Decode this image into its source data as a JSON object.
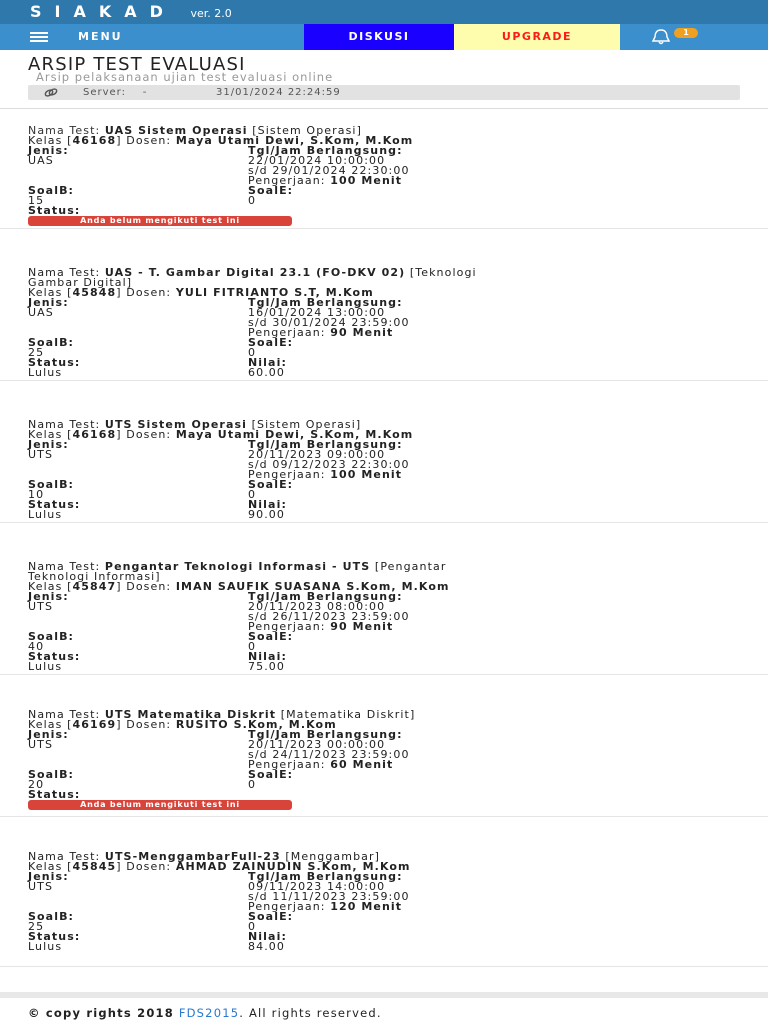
{
  "app": {
    "brand": "SIAKAD",
    "version": "ver. 2.0"
  },
  "nav": {
    "menu_label": "MENU",
    "diskusi_label": "DISKUSI",
    "upgrade_label": "UPGRADE",
    "notification_count": "1"
  },
  "header": {
    "title": "ARSIP TEST EVALUASI",
    "subtitle": "Arsip pelaksanaan ujian test evaluasi online",
    "server_label": "Server:",
    "server_sep": "-",
    "server_time": "31/01/2024 22:24:59"
  },
  "labels": {
    "nama_test": "Nama Test:",
    "kelas": "Kelas",
    "dosen": "Dosen:",
    "jenis": "Jenis:",
    "tgl": "Tgl/Jam Berlangsung:",
    "sd": "s/d",
    "pengerjaan": "Pengerjaan:",
    "soalb": "SoalB:",
    "soale": "SoalE:",
    "status": "Status:",
    "nilai": "Nilai:"
  },
  "tests": [
    {
      "name": "UAS Sistem Operasi",
      "course": "[Sistem Operasi]",
      "kelas": "46168",
      "dosen": "Maya Utami Dewi, S.Kom, M.Kom",
      "jenis": "UAS",
      "start": "22/01/2024 10:00:00",
      "end": "29/01/2024 22:30:00",
      "duration": "100 Menit",
      "soalb": "15",
      "soale": "0",
      "status": "",
      "nilai": "",
      "badge": "Anda belum mengikuti test ini"
    },
    {
      "name": "UAS - T. Gambar Digital 23.1 (FO-DKV 02)",
      "course": "[Teknologi",
      "course_cont": "Gambar Digital]",
      "kelas": "45848",
      "dosen": "YULI FITRIANTO S.T, M.Kom",
      "jenis": "UAS",
      "start": "16/01/2024 13:00:00",
      "end": "30/01/2024 23:59:00",
      "duration": "90 Menit",
      "soalb": "25",
      "soale": "0",
      "status": "Lulus",
      "nilai": "60.00"
    },
    {
      "name": "UTS Sistem Operasi",
      "course": "[Sistem Operasi]",
      "kelas": "46168",
      "dosen": "Maya Utami Dewi, S.Kom, M.Kom",
      "jenis": "UTS",
      "start": "20/11/2023 09:00:00",
      "end": "09/12/2023 22:30:00",
      "duration": "100 Menit",
      "soalb": "10",
      "soale": "0",
      "status": "Lulus",
      "nilai": "90.00"
    },
    {
      "name": "Pengantar Teknologi Informasi - UTS",
      "course": "[Pengantar",
      "course_cont": "Teknologi Informasi]",
      "kelas": "45847",
      "dosen": "IMAN SAUFIK SUASANA S.Kom, M.Kom",
      "jenis": "UTS",
      "start": "20/11/2023 08:00:00",
      "end": "26/11/2023 23:59:00",
      "duration": "90 Menit",
      "soalb": "40",
      "soale": "0",
      "status": "Lulus",
      "nilai": "75.00"
    },
    {
      "name": "UTS Matematika Diskrit",
      "course": "[Matematika Diskrit]",
      "kelas": "46169",
      "dosen": "RUSITO S.Kom, M.Kom",
      "jenis": "UTS",
      "start": "20/11/2023 00:00:00",
      "end": "24/11/2023 23:59:00",
      "duration": "60 Menit",
      "soalb": "20",
      "soale": "0",
      "status": "",
      "nilai": "",
      "badge": "Anda belum mengikuti test ini"
    },
    {
      "name": "UTS-MenggambarFull-23",
      "course": "[Menggambar]",
      "kelas": "45845",
      "dosen": "AHMAD ZAINUDIN S.Kom, M.Kom",
      "jenis": "UTS",
      "start": "09/11/2023 14:00:00",
      "end": "11/11/2023 23:59:00",
      "duration": "120 Menit",
      "soalb": "25",
      "soale": "0",
      "status": "Lulus",
      "nilai": "84.00"
    }
  ],
  "footer": {
    "prefix": "© copy rights 2018",
    "link": "FDS2015",
    "suffix": ". All rights reserved."
  },
  "colors": {
    "topbar": "#2f78ab",
    "navbar": "#3b8fcd",
    "diskusi": "#1a00ff",
    "upgrade_bg": "#fdfdad",
    "upgrade_text": "#ff1a1a",
    "badge": "#d9443a"
  }
}
